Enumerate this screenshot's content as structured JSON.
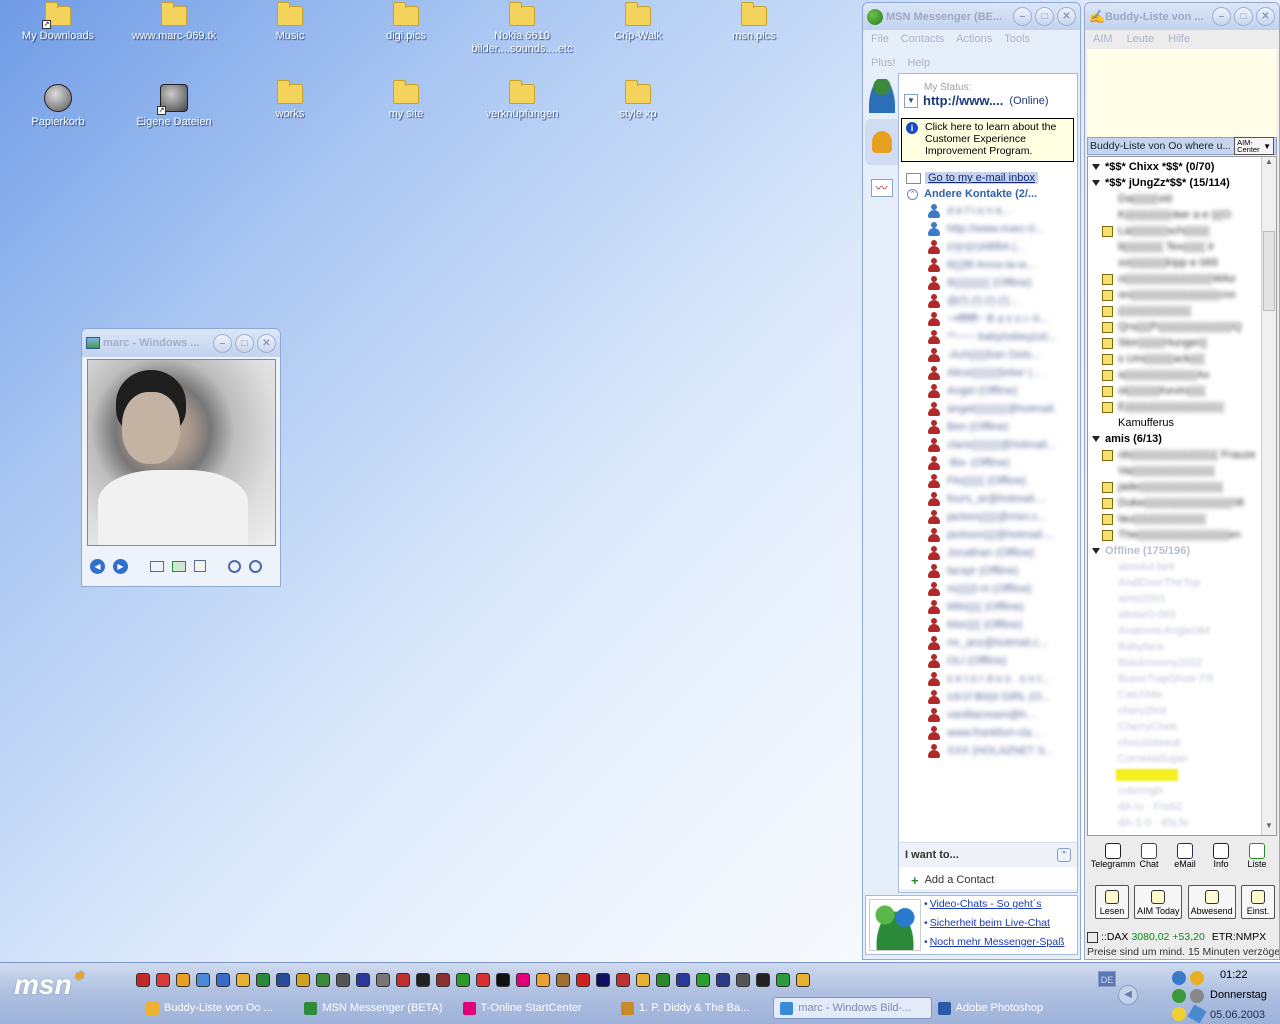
{
  "desktop": {
    "icons_row1": [
      {
        "label": "My Downloads",
        "type": "folder",
        "shortcut": true
      },
      {
        "label": "www.marc-069.tk",
        "type": "folder"
      },
      {
        "label": "Music",
        "type": "folder"
      },
      {
        "label": "digi.pics",
        "type": "folder"
      },
      {
        "label": "Nokia 6610 bilder....sounds....etc",
        "type": "folder"
      },
      {
        "label": "Crip-Walk",
        "type": "folder"
      },
      {
        "label": "msn.pics",
        "type": "folder"
      }
    ],
    "icons_row2": [
      {
        "label": "Papierkorb",
        "type": "recycle"
      },
      {
        "label": "Eigene Dateien",
        "type": "documents",
        "shortcut": true
      },
      {
        "label": "works",
        "type": "folder"
      },
      {
        "label": "my site",
        "type": "folder"
      },
      {
        "label": "verknüpfungen",
        "type": "folder"
      },
      {
        "label": "style xp",
        "type": "folder"
      }
    ]
  },
  "image_viewer": {
    "title": "marc - Windows ...",
    "controls": [
      "previous-icon",
      "next-icon",
      "best-fit-icon",
      "actual-size-icon",
      "slideshow-icon",
      "zoom-in-icon",
      "zoom-out-icon"
    ]
  },
  "msn": {
    "title": "MSN Messenger (BE...",
    "menu": [
      "File",
      "Contacts",
      "Actions",
      "Tools",
      "Plus!",
      "Help"
    ],
    "status_label": "My Status:",
    "status_name": "http://www....",
    "status_state": "(Online)",
    "info_text": "Click here to learn about the Customer Experience Improvement Program.",
    "inbox_link": "Go to my e-mail inbox",
    "group_label": "Andere Kontakte (2/...",
    "contacts": [
      {
        "name": "d e f t o n e...",
        "online": true
      },
      {
        "name": "http://www.marc-0...",
        "online": true
      },
      {
        "name": "(•)(•)(•)ABBA (...",
        "online": false
      },
      {
        "name": "8(((Bl Anna-ta-w...",
        "online": false
      },
      {
        "name": "8(((((((((( (Offline)",
        "online": false
      },
      {
        "name": "@(!) (!) (!) (!)...",
        "online": false
      },
      {
        "name": "~•fffffff~ B a s s i--0...",
        "online": false
      },
      {
        "name": "**~~~ babyhobey(u0...",
        "online": false
      },
      {
        "name": "-Ach(((((kan Dots...",
        "online": false
      },
      {
        "name": "Alice((((((((brker (...",
        "online": false
      },
      {
        "name": "Angel (Offline)",
        "online": false
      },
      {
        "name": "angel(((((((((@hotmail....",
        "online": false
      },
      {
        "name": "Ben (Offline)",
        "online": false
      },
      {
        "name": "clare((((((((@hotmail....",
        "online": false
      },
      {
        "name": "-Ba- (Offline)",
        "online": false
      },
      {
        "name": "Flo(((((( (Offline)",
        "online": false
      },
      {
        "name": "fours_ar@hotmail....",
        "online": false
      },
      {
        "name": "jacken(((((@msn.c...",
        "online": false
      },
      {
        "name": "jackson(((@hotmail....",
        "online": false
      },
      {
        "name": "Jonathan (Offline)",
        "online": false
      },
      {
        "name": "lacspr (Offline)",
        "online": false
      },
      {
        "name": "m(((((l-m (Offline)",
        "online": false
      },
      {
        "name": "Milo(((( (Offline)",
        "online": false
      },
      {
        "name": "Mor(((( (Offline)",
        "online": false
      },
      {
        "name": "mr_anz@hotmail.c...",
        "online": false
      },
      {
        "name": "OLI (Offline)",
        "online": false
      },
      {
        "name": "s e t o r d o s . s n t...",
        "online": false
      },
      {
        "name": "s3r1f B0(d GIRL (O...",
        "online": false
      },
      {
        "name": "vanillacream@h...",
        "online": false
      },
      {
        "name": "www.frankfurt-cla...",
        "online": false
      },
      {
        "name": "XXX (HOLAZNET S...",
        "online": false
      }
    ],
    "iwant_label": "I want to...",
    "add_contact": "Add a Contact",
    "links": [
      "Video-Chats - So geht´s",
      "Sicherheit beim Live-Chat",
      "Noch mehr Messenger-Spaß"
    ]
  },
  "aim": {
    "title": "Buddy-Liste von ...",
    "menu": [
      "AIM",
      "Leute",
      "Hilfe"
    ],
    "header_label": "Buddy-Liste von Oo where u...",
    "aim_center": "AIM-Center",
    "buddies": [
      {
        "kind": "group",
        "text": "*$$* Chixx *$$* (0/70)"
      },
      {
        "kind": "group",
        "text": "*$$* jUngZz*$$* (15/114)"
      },
      {
        "kind": "buddy",
        "text": "Da(((((((vid",
        "blur": true,
        "note": false
      },
      {
        "kind": "buddy",
        "text": "K((((((((((((cker a e (((O",
        "blur": true,
        "note": false
      },
      {
        "kind": "buddy",
        "text": "La((((((((((sch(((((((",
        "blur": true,
        "note": true
      },
      {
        "kind": "buddy",
        "text": "li((((((((((( Tex(((((( lr",
        "blur": true,
        "note": false
      },
      {
        "kind": "buddy",
        "text": "xo((((((((((kIpp e 069",
        "blur": true,
        "note": false
      },
      {
        "kind": "buddy",
        "text": "o((((((((((((((((((((((((WAo",
        "blur": true,
        "note": true
      },
      {
        "kind": "buddy",
        "text": "on((((((((((((((((((((((((cnn",
        "blur": true,
        "note": true
      },
      {
        "kind": "buddy",
        "text": "((((((((((((((((((((",
        "blur": true,
        "note": true
      },
      {
        "kind": "buddy",
        "text": "Qrs((((P((((((((((((((((((((iQ",
        "blur": true,
        "note": true
      },
      {
        "kind": "buddy",
        "text": "Stor(((((((Hunger((",
        "blur": true,
        "note": true
      },
      {
        "kind": "buddy",
        "text": "s Um((((((((ack((((",
        "blur": true,
        "note": true
      },
      {
        "kind": "buddy",
        "text": "s((((((((((((((((((((Ax",
        "blur": true,
        "note": true
      },
      {
        "kind": "buddy",
        "text": "ol(((((((((Kevin(((((",
        "blur": true,
        "note": true
      },
      {
        "kind": "buddy",
        "text": "E(((((((((((((((((((((((((((",
        "blur": true,
        "note": true
      },
      {
        "kind": "buddy",
        "text": "Kamufferus",
        "blur": false,
        "note": false
      },
      {
        "kind": "group",
        "text": "amis (6/13)"
      },
      {
        "kind": "buddy",
        "text": "ob(((((((((((((((((((((((( Frauze",
        "blur": true,
        "note": true
      },
      {
        "kind": "buddy",
        "text": "Va(((((((((((((((((((((((",
        "blur": true,
        "note": false
      },
      {
        "kind": "buddy",
        "text": "jade(((((((((((((((((((((((",
        "blur": true,
        "note": true
      },
      {
        "kind": "buddy",
        "text": "Duke((((((((((((((((((((((((08",
        "blur": true,
        "note": true
      },
      {
        "kind": "buddy",
        "text": "lau((((((((((((((((((((",
        "blur": true,
        "note": true
      },
      {
        "kind": "buddy",
        "text": "The(((((((((((((((((((((((((en",
        "blur": true,
        "note": true
      },
      {
        "kind": "offline",
        "text": "Offline (175/196)"
      },
      {
        "kind": "off",
        "text": "absolut-lark"
      },
      {
        "kind": "off",
        "text": "AndiDoorTheTop"
      },
      {
        "kind": "off",
        "text": "amis2001"
      },
      {
        "kind": "off",
        "text": "allstar0-069"
      },
      {
        "kind": "off",
        "text": "AnatomicAngle084"
      },
      {
        "kind": "off",
        "text": "Babyface"
      },
      {
        "kind": "off",
        "text": "Blackmoony2002"
      },
      {
        "kind": "off",
        "text": "BravoTrapShow FR"
      },
      {
        "kind": "off",
        "text": "CatchMe"
      },
      {
        "kind": "off",
        "text": "chery2hot"
      },
      {
        "kind": "off",
        "text": "CherryChee"
      },
      {
        "kind": "off",
        "text": "chocolateeat"
      },
      {
        "kind": "off",
        "text": "CorneliaSuper"
      },
      {
        "kind": "hl",
        "text": "((((((((((((((((("
      },
      {
        "kind": "off",
        "text": "cvbnmgh"
      },
      {
        "kind": "off",
        "text": "dA ru - Fre62"
      },
      {
        "kind": "off",
        "text": "dA-1-0 - 45Lfe"
      }
    ],
    "actions": [
      "Telegramm",
      "Chat",
      "eMail",
      "Info",
      "Liste"
    ],
    "big_buttons": [
      "Lesen",
      "AIM Today",
      "Abwesend",
      "Einst."
    ],
    "ticker_symbol": "::DAX",
    "ticker_value": "3080,02",
    "ticker_change": "+53,20",
    "ticker_etr": "ETR:NMPX",
    "ticker_news": "Preise sind um mind. 15 Minuten verzöge"
  },
  "taskbar": {
    "logo": "msn",
    "tasks": [
      {
        "label": "Buddy-Liste von Oo ...",
        "color": "#f0b030",
        "active": false
      },
      {
        "label": "MSN Messenger (BETA)",
        "color": "#2f8a3a",
        "active": false
      },
      {
        "label": "T-Online StartCenter",
        "color": "#e2007a",
        "active": false
      },
      {
        "label": "1. P. Diddy & The Ba...",
        "color": "#c98a2a",
        "active": false
      },
      {
        "label": "marc - Windows Bild-...",
        "color": "#3a8ad8",
        "active": true
      },
      {
        "label": "Adobe Photoshop",
        "color": "#2a5aa8",
        "active": false
      }
    ],
    "lang": "DE",
    "clock_time": "01:22",
    "clock_day": "Donnerstag",
    "clock_date": "05.06.2003"
  }
}
